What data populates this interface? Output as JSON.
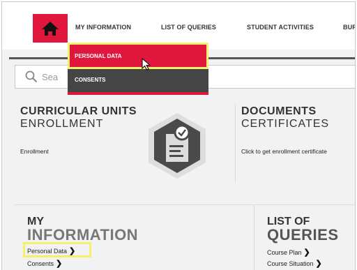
{
  "nav": {
    "items": [
      "MY INFORMATION",
      "LIST OF QUERIES",
      "STUDENT ACTIVITIES",
      "BUR"
    ]
  },
  "dropdown": {
    "items": [
      "PERSONAL DATA",
      "CONSENTS"
    ]
  },
  "search": {
    "placeholder": "Sea"
  },
  "cards": {
    "enrollment": {
      "title": "CURRICULAR UNITS",
      "subtitle": "ENROLLMENT",
      "link": "Enrollment"
    },
    "documents": {
      "title": "DOCUMENTS",
      "subtitle": "CERTIFICATES",
      "link": "Click to get enrollment certificate"
    }
  },
  "bottom": {
    "my_information": {
      "line1": "MY",
      "line2": "INFORMATION",
      "links": [
        "Personal Data",
        "Consents"
      ]
    },
    "list_of_queries": {
      "line1": "LIST OF",
      "line2": "QUERIES",
      "links": [
        "Course Plan",
        "Course Situation"
      ]
    }
  },
  "colors": {
    "accent": "#e1163c",
    "highlight": "#f4f06a",
    "dark": "#454545"
  },
  "icons": {
    "home": "home-icon",
    "search": "search-icon",
    "certificate": "certificate-badge-icon",
    "cursor": "mouse-pointer-icon",
    "chevron": "chevron-right-icon"
  }
}
